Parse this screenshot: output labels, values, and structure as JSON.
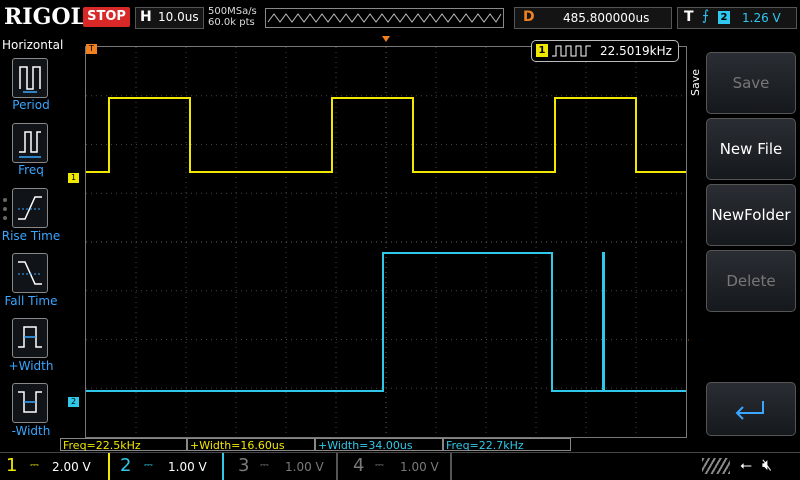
{
  "top": {
    "brand": "RIGOL",
    "run_state": "STOP",
    "horizontal_key": "H",
    "timebase": "10.0us",
    "sample_rate": "500MSa/s",
    "memory_depth": "60.0k pts",
    "delay_key": "D",
    "delay_value": "485.800000us",
    "trigger_key": "T",
    "trigger_channel": "2",
    "trigger_level": "1.26 V"
  },
  "left_panel": {
    "title": "Horizontal",
    "items": [
      {
        "label": "Period",
        "icon": "period-icon"
      },
      {
        "label": "Freq",
        "icon": "frequency-icon"
      },
      {
        "label": "Rise Time",
        "icon": "rise-time-icon"
      },
      {
        "label": "Fall Time",
        "icon": "fall-time-icon"
      },
      {
        "label": "+Width",
        "icon": "positive-width-icon"
      },
      {
        "label": "-Width",
        "icon": "negative-width-icon"
      }
    ]
  },
  "freq_counter": {
    "channel": "1",
    "value": "22.5019kHz"
  },
  "markers": {
    "trigger_pos": "T",
    "ch1": "1",
    "ch2": "2"
  },
  "right_panel": {
    "tab": "Save",
    "buttons": [
      {
        "label": "Save",
        "enabled": false
      },
      {
        "label": "New File",
        "enabled": true
      },
      {
        "label": "NewFolder",
        "enabled": true
      },
      {
        "label": "Delete",
        "enabled": false
      }
    ]
  },
  "measurements": [
    "Freq=22.5kHz",
    "+Width=16.60us",
    "+Width=34.00us",
    "Freq=22.7kHz"
  ],
  "channels": [
    {
      "num": "1",
      "scale": "2.00 V",
      "color": "#f0e800",
      "active": true
    },
    {
      "num": "2",
      "scale": "1.00 V",
      "color": "#30c8e8",
      "active": true
    },
    {
      "num": "3",
      "scale": "1.00 V",
      "color": "#7a7a7a",
      "active": false
    },
    {
      "num": "4",
      "scale": "1.00 V",
      "color": "#7a7a7a",
      "active": false
    }
  ],
  "colors": {
    "ch1": "#f0e800",
    "ch2": "#30c8e8",
    "stop": "#d82828",
    "accent_blue": "#3aa6ff",
    "trigger_orange": "#f08020"
  }
}
